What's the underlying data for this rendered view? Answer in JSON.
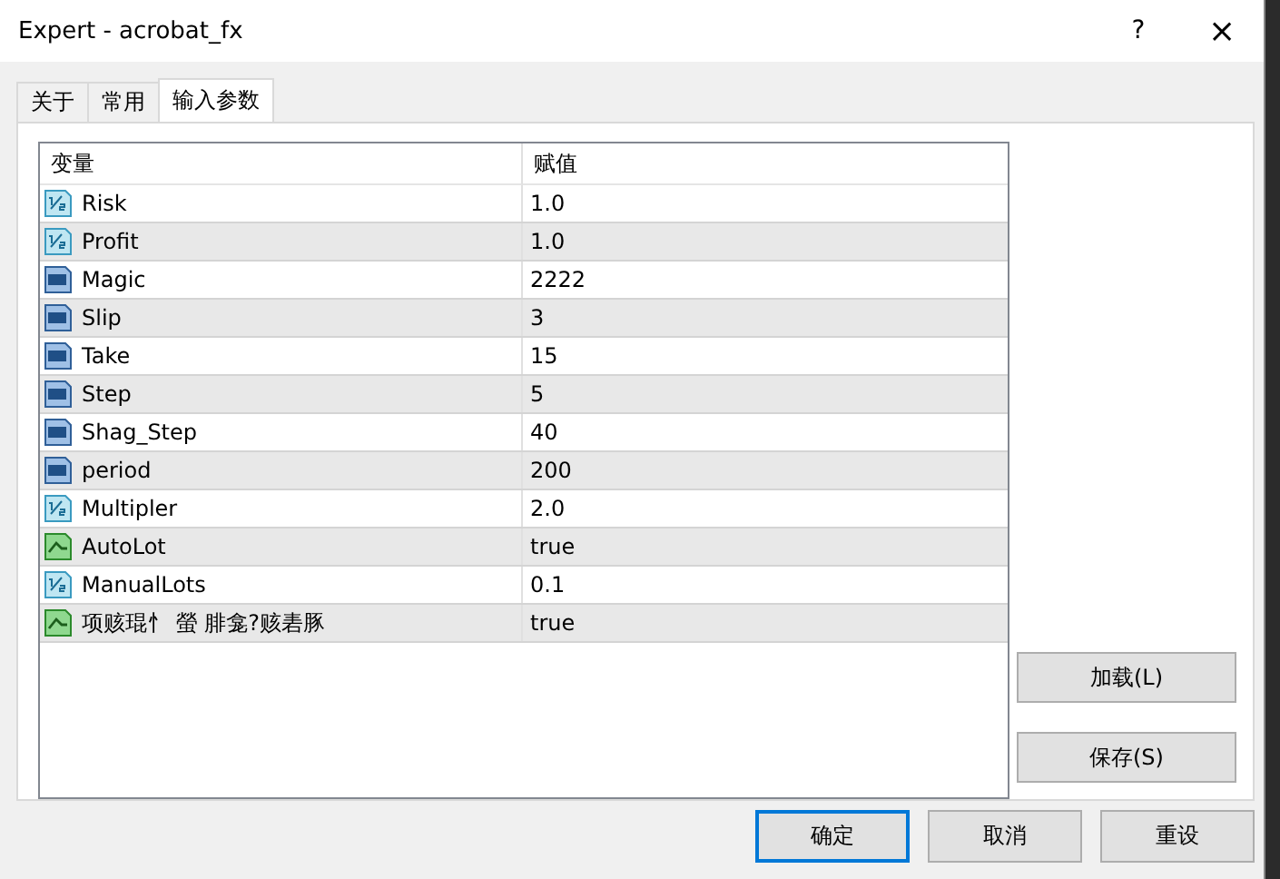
{
  "window": {
    "title": "Expert - acrobat_fx",
    "help": "?",
    "close": "×"
  },
  "tabs": [
    {
      "label": "关于",
      "selected": false
    },
    {
      "label": "常用",
      "selected": false
    },
    {
      "label": "输入参数",
      "selected": true
    }
  ],
  "table": {
    "columns": [
      "变量",
      "赋值"
    ],
    "rows": [
      {
        "kind": "double",
        "name": "Risk",
        "value": "1.0"
      },
      {
        "kind": "double",
        "name": "Profit",
        "value": "1.0"
      },
      {
        "kind": "int",
        "name": "Magic",
        "value": "2222"
      },
      {
        "kind": "int",
        "name": "Slip",
        "value": "3"
      },
      {
        "kind": "int",
        "name": "Take",
        "value": "15"
      },
      {
        "kind": "int",
        "name": "Step",
        "value": "5"
      },
      {
        "kind": "int",
        "name": "Shag_Step",
        "value": "40"
      },
      {
        "kind": "int",
        "name": "period",
        "value": "200"
      },
      {
        "kind": "double",
        "name": "Multipler",
        "value": "2.0"
      },
      {
        "kind": "bool",
        "name": "AutoLot",
        "value": "true"
      },
      {
        "kind": "double",
        "name": "ManualLots",
        "value": "0.1"
      },
      {
        "kind": "bool",
        "name": "项赅琨忄 螢 腓龛?赅砉豚",
        "value": "true"
      }
    ]
  },
  "side_buttons": [
    "加载(L)",
    "保存(S)"
  ],
  "buttons": [
    {
      "label": "确定",
      "selected": true
    },
    {
      "label": "取消",
      "selected": false
    },
    {
      "label": "重设",
      "selected": false
    }
  ]
}
